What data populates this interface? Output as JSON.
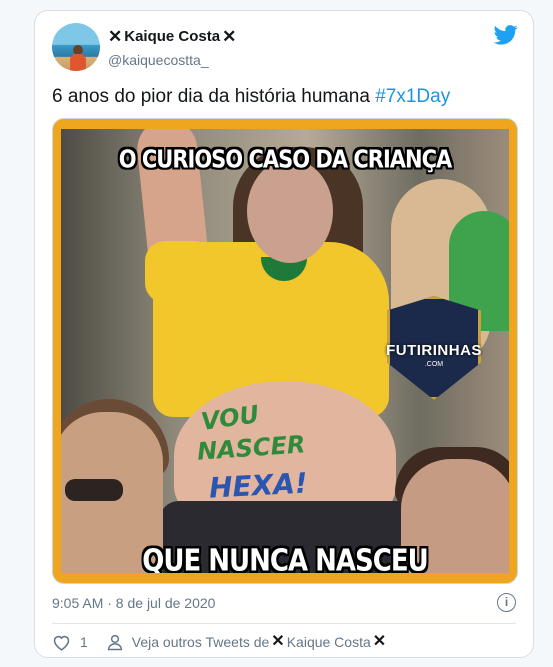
{
  "tweet": {
    "author": {
      "display_name": "Kaique Costa",
      "name_prefix_icon": "✕",
      "name_suffix_icon": "✕",
      "handle": "@kaiquecostta_",
      "avatar_icon": "avatar"
    },
    "brand_icon": "twitter-bird-icon",
    "text": "6 anos do pior dia da história humana ",
    "hashtag": "#7x1Day",
    "media": {
      "caption_top": "O CURIOSO CASO DA CRIANÇA",
      "caption_bottom": "QUE NUNCA NASCEU",
      "belly_line1": "VOU",
      "belly_line2": "NASCER",
      "belly_line3": "HEXA!",
      "watermark": "FUTIRINHAS",
      "watermark_sub": ".COM"
    },
    "timestamp": "9:05 AM · 8 de jul de 2020",
    "info_icon": "i",
    "likes": "1",
    "more_tweets_label": "Veja outros Tweets de "
  },
  "colors": {
    "accent": "#1b95e0",
    "frame": "#f0a51f",
    "secondary_text": "#657786"
  }
}
